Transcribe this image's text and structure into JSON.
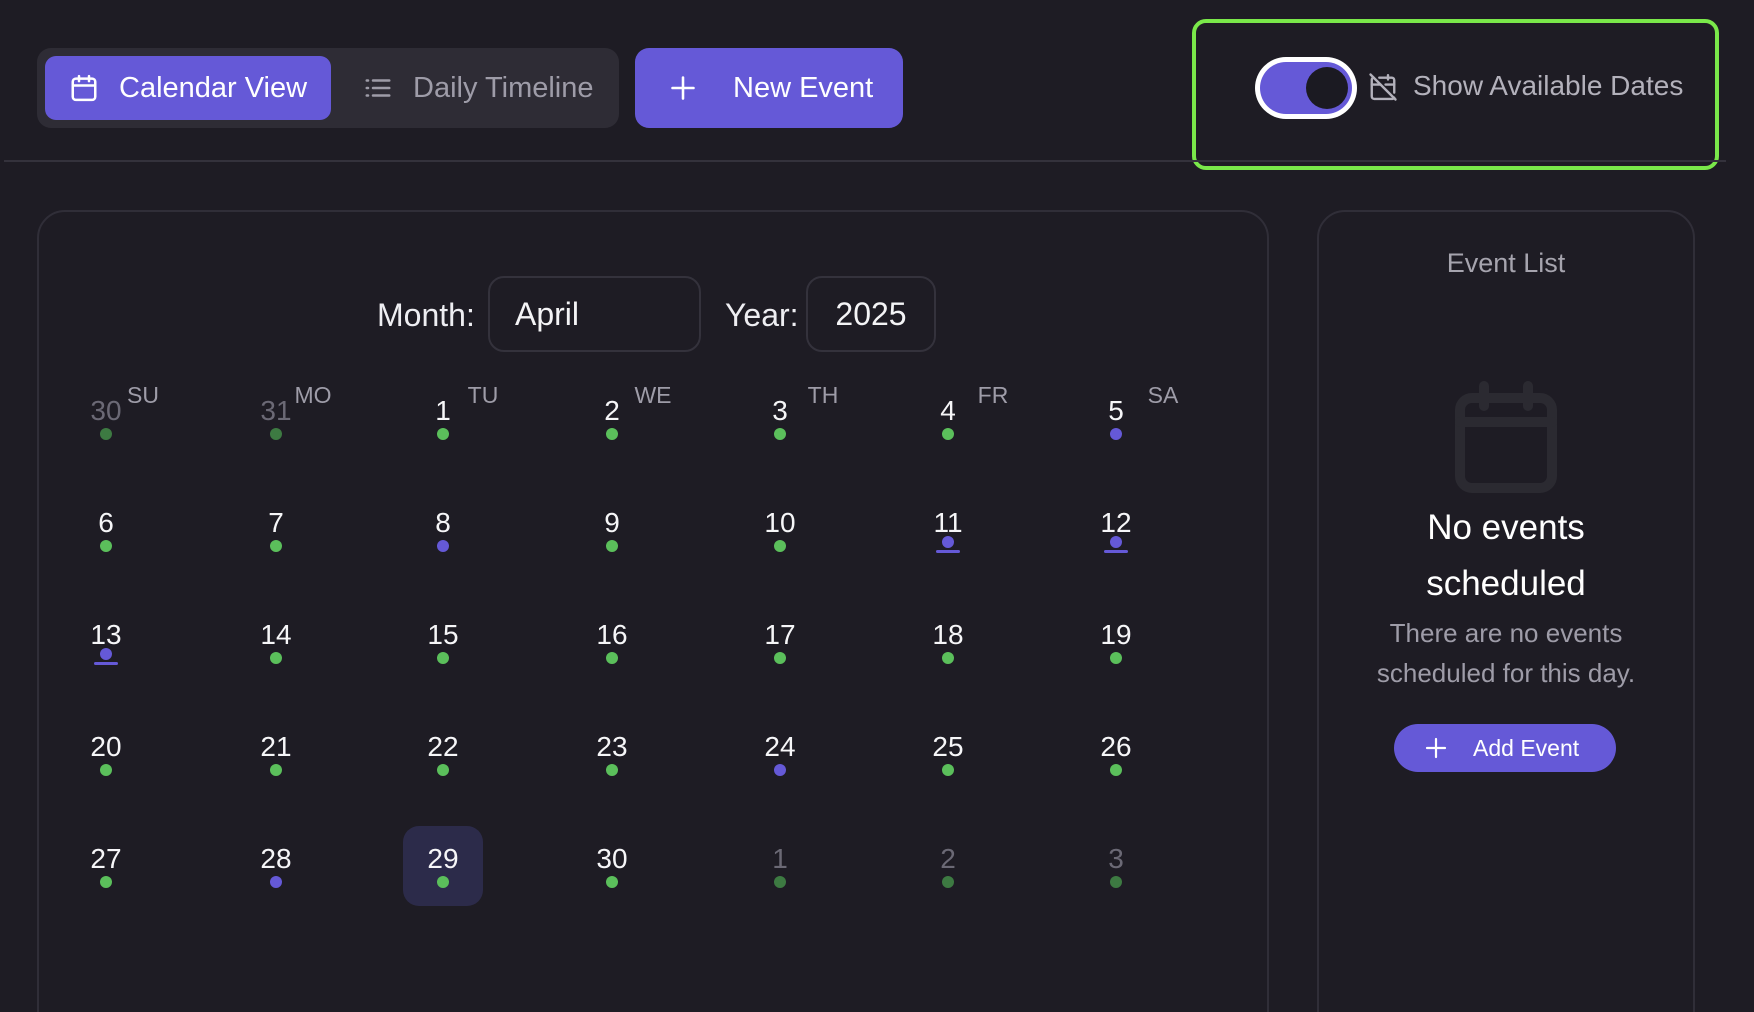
{
  "toolbar": {
    "calendar_view_label": "Calendar View",
    "daily_timeline_label": "Daily Timeline",
    "new_event_label": "New Event",
    "show_available_label": "Show Available Dates",
    "show_available_enabled": true,
    "highlight_color": "#7ae84a"
  },
  "colors": {
    "accent": "#6559d7",
    "available": "#5bbf5b",
    "available_muted": "#3d7a42",
    "booked": "#6559d7",
    "background": "#1e1c24"
  },
  "icons": {
    "calendar_view": "calendar-icon",
    "daily_timeline": "list-icon",
    "new_event": "plus-icon",
    "show_available": "calendar-off-icon",
    "empty_state": "calendar-icon",
    "add_event": "plus-icon"
  },
  "calendar": {
    "month_label": "Month:",
    "month_value": "April",
    "year_label": "Year:",
    "year_value": "2025",
    "weekdays": [
      "SU",
      "MO",
      "TU",
      "WE",
      "TH",
      "FR",
      "SA"
    ],
    "selected_day": "29",
    "days": [
      {
        "num": "30",
        "muted": true,
        "status": "available"
      },
      {
        "num": "31",
        "muted": true,
        "status": "available"
      },
      {
        "num": "1",
        "muted": false,
        "status": "available"
      },
      {
        "num": "2",
        "muted": false,
        "status": "available"
      },
      {
        "num": "3",
        "muted": false,
        "status": "available"
      },
      {
        "num": "4",
        "muted": false,
        "status": "available"
      },
      {
        "num": "5",
        "muted": false,
        "status": "booked"
      },
      {
        "num": "6",
        "muted": false,
        "status": "available"
      },
      {
        "num": "7",
        "muted": false,
        "status": "available"
      },
      {
        "num": "8",
        "muted": false,
        "status": "booked"
      },
      {
        "num": "9",
        "muted": false,
        "status": "available"
      },
      {
        "num": "10",
        "muted": false,
        "status": "available"
      },
      {
        "num": "11",
        "muted": false,
        "status": "busy"
      },
      {
        "num": "12",
        "muted": false,
        "status": "busy"
      },
      {
        "num": "13",
        "muted": false,
        "status": "busy"
      },
      {
        "num": "14",
        "muted": false,
        "status": "available"
      },
      {
        "num": "15",
        "muted": false,
        "status": "available"
      },
      {
        "num": "16",
        "muted": false,
        "status": "available"
      },
      {
        "num": "17",
        "muted": false,
        "status": "available"
      },
      {
        "num": "18",
        "muted": false,
        "status": "available"
      },
      {
        "num": "19",
        "muted": false,
        "status": "available"
      },
      {
        "num": "20",
        "muted": false,
        "status": "available"
      },
      {
        "num": "21",
        "muted": false,
        "status": "available"
      },
      {
        "num": "22",
        "muted": false,
        "status": "available"
      },
      {
        "num": "23",
        "muted": false,
        "status": "available"
      },
      {
        "num": "24",
        "muted": false,
        "status": "booked"
      },
      {
        "num": "25",
        "muted": false,
        "status": "available"
      },
      {
        "num": "26",
        "muted": false,
        "status": "available"
      },
      {
        "num": "27",
        "muted": false,
        "status": "available"
      },
      {
        "num": "28",
        "muted": false,
        "status": "booked"
      },
      {
        "num": "29",
        "muted": false,
        "status": "available",
        "selected": true
      },
      {
        "num": "30",
        "muted": false,
        "status": "available"
      },
      {
        "num": "1",
        "muted": true,
        "status": "available"
      },
      {
        "num": "2",
        "muted": true,
        "status": "available"
      },
      {
        "num": "3",
        "muted": true,
        "status": "available"
      }
    ]
  },
  "event_list": {
    "title": "Event List",
    "empty_heading_line1": "No events",
    "empty_heading_line2": "scheduled",
    "empty_sub_line1": "There are no events",
    "empty_sub_line2": "scheduled for this day.",
    "add_event_label": "Add Event"
  }
}
